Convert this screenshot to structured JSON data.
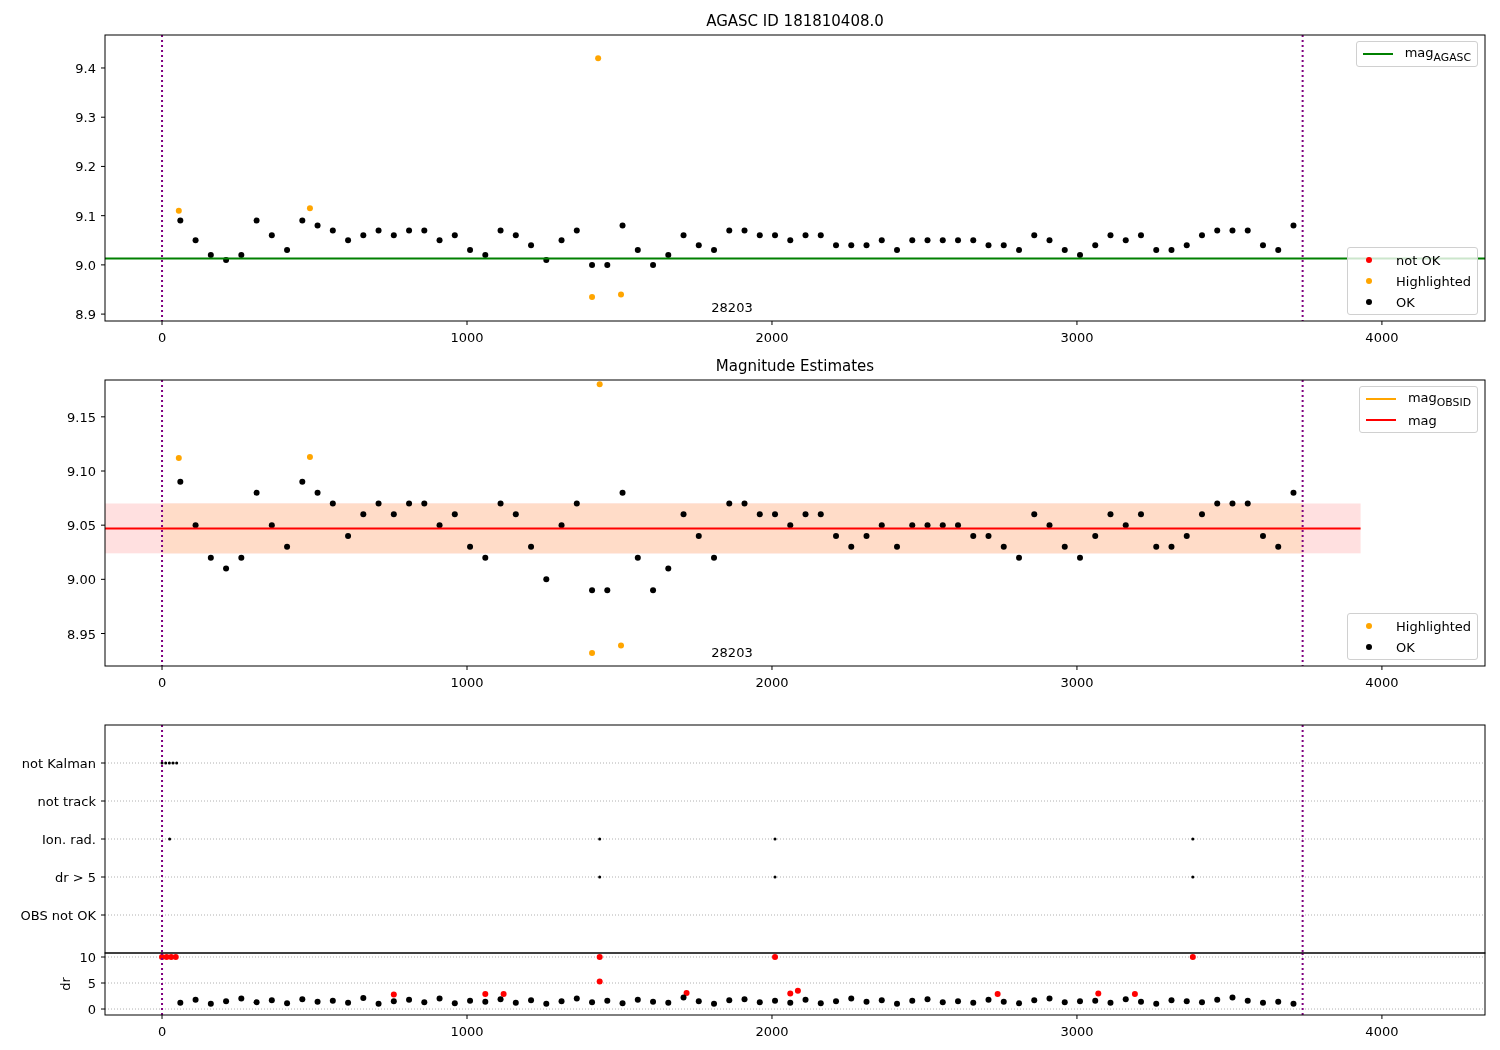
{
  "panels": [
    {
      "title": "AGASC ID 181810408.0",
      "legends": [
        {
          "entries": [
            {
              "kind": "line",
              "label": "mag$_{AGASC}$",
              "color": "#008000"
            }
          ]
        },
        {
          "entries": [
            {
              "kind": "dot",
              "label": "not OK",
              "color": "#ff0000"
            },
            {
              "kind": "dot",
              "label": "Highlighted",
              "color": "#ffa500"
            },
            {
              "kind": "dot",
              "label": "OK",
              "color": "#000000"
            }
          ]
        }
      ],
      "chart_data": {
        "type": "scatter",
        "xlim": [
          -187,
          4338
        ],
        "ylim": [
          8.886,
          9.467
        ],
        "xticks": [
          0,
          1000,
          2000,
          3000,
          4000
        ],
        "yticks": [
          {
            "value": 8.9,
            "label": "8.9"
          },
          {
            "value": 9.0,
            "label": "9.0"
          },
          {
            "value": 9.1,
            "label": "9.1"
          },
          {
            "value": 9.2,
            "label": "9.2"
          },
          {
            "value": 9.3,
            "label": "9.3"
          },
          {
            "value": 9.4,
            "label": "9.4"
          }
        ],
        "x": [
          60,
          110,
          160,
          210,
          260,
          310,
          360,
          410,
          460,
          510,
          560,
          610,
          660,
          710,
          760,
          810,
          860,
          910,
          960,
          1010,
          1060,
          1110,
          1160,
          1210,
          1260,
          1310,
          1360,
          1410,
          1460,
          1510,
          1560,
          1610,
          1660,
          1710,
          1760,
          1810,
          1860,
          1910,
          1960,
          2010,
          2060,
          2110,
          2160,
          2210,
          2260,
          2310,
          2360,
          2410,
          2460,
          2510,
          2560,
          2610,
          2660,
          2710,
          2760,
          2810,
          2860,
          2910,
          2960,
          3010,
          3060,
          3110,
          3160,
          3210,
          3260,
          3310,
          3360,
          3410,
          3460,
          3510,
          3560,
          3610,
          3660,
          3710
        ],
        "series": [
          {
            "color": "#ffa500",
            "x": [
              55,
              485,
              1430,
              1410,
              1505
            ],
            "values": [
              9.11,
              9.115,
              9.42,
              8.935,
              8.94
            ]
          },
          {
            "color": "#000000",
            "values": [
              9.09,
              9.05,
              9.02,
              9.01,
              9.02,
              9.09,
              9.06,
              9.03,
              9.09,
              9.08,
              9.07,
              9.05,
              9.06,
              9.07,
              9.06,
              9.07,
              9.07,
              9.05,
              9.06,
              9.03,
              9.02,
              9.07,
              9.06,
              9.04,
              9.01,
              9.05,
              9.07,
              9.0,
              9.0,
              9.08,
              9.03,
              9.0,
              9.02,
              9.06,
              9.04,
              9.03,
              9.07,
              9.07,
              9.06,
              9.06,
              9.05,
              9.06,
              9.06,
              9.04,
              9.04,
              9.04,
              9.05,
              9.03,
              9.05,
              9.05,
              9.05,
              9.05,
              9.05,
              9.04,
              9.04,
              9.03,
              9.06,
              9.05,
              9.03,
              9.02,
              9.04,
              9.06,
              9.05,
              9.06,
              9.03,
              9.03,
              9.04,
              9.06,
              9.07,
              9.07,
              9.07,
              9.04,
              9.03,
              9.08
            ]
          }
        ],
        "ref_lines": [
          {
            "axis": "y",
            "value": 9.013,
            "color": "#008000"
          },
          {
            "axis": "x",
            "value": 0,
            "color": "#800080"
          },
          {
            "axis": "x",
            "value": 3740,
            "color": "#800080"
          }
        ],
        "annotations": [
          "28203"
        ]
      }
    },
    {
      "title": "Magnitude Estimates",
      "legends": [
        {
          "entries": [
            {
              "kind": "line",
              "label": "mag$_{OBSID}$",
              "color": "#ffa500"
            },
            {
              "kind": "line",
              "label": "mag",
              "color": "#ff0000"
            }
          ]
        },
        {
          "entries": [
            {
              "kind": "dot",
              "label": "Highlighted",
              "color": "#ffa500"
            },
            {
              "kind": "dot",
              "label": "OK",
              "color": "#000000"
            }
          ]
        }
      ],
      "chart_data": {
        "type": "scatter",
        "xlim": [
          -187,
          4338
        ],
        "ylim": [
          8.92,
          9.184
        ],
        "xticks": [
          0,
          1000,
          2000,
          3000,
          4000
        ],
        "yticks": [
          {
            "value": 8.95,
            "label": "8.95"
          },
          {
            "value": 9.0,
            "label": "9.00"
          },
          {
            "value": 9.05,
            "label": "9.05"
          },
          {
            "value": 9.1,
            "label": "9.10"
          },
          {
            "value": 9.15,
            "label": "9.15"
          }
        ],
        "x": [
          60,
          110,
          160,
          210,
          260,
          310,
          360,
          410,
          460,
          510,
          560,
          610,
          660,
          710,
          760,
          810,
          860,
          910,
          960,
          1010,
          1060,
          1110,
          1160,
          1210,
          1260,
          1310,
          1360,
          1410,
          1460,
          1510,
          1560,
          1610,
          1660,
          1710,
          1760,
          1810,
          1860,
          1910,
          1960,
          2010,
          2060,
          2110,
          2160,
          2210,
          2260,
          2310,
          2360,
          2410,
          2460,
          2510,
          2560,
          2610,
          2660,
          2710,
          2760,
          2810,
          2860,
          2910,
          2960,
          3010,
          3060,
          3110,
          3160,
          3210,
          3260,
          3310,
          3360,
          3410,
          3460,
          3510,
          3560,
          3610,
          3660,
          3710
        ],
        "series": [
          {
            "color": "#ffa500",
            "x": [
              55,
              485,
              1435,
              1410,
              1505
            ],
            "values": [
              9.112,
              9.113,
              9.18,
              8.932,
              8.939
            ]
          },
          {
            "color": "#000000",
            "values": [
              9.09,
              9.05,
              9.02,
              9.01,
              9.02,
              9.08,
              9.05,
              9.03,
              9.09,
              9.08,
              9.07,
              9.04,
              9.06,
              9.07,
              9.06,
              9.07,
              9.07,
              9.05,
              9.06,
              9.03,
              9.02,
              9.07,
              9.06,
              9.03,
              9.0,
              9.05,
              9.07,
              8.99,
              8.99,
              9.08,
              9.02,
              8.99,
              9.01,
              9.06,
              9.04,
              9.02,
              9.07,
              9.07,
              9.06,
              9.06,
              9.05,
              9.06,
              9.06,
              9.04,
              9.03,
              9.04,
              9.05,
              9.03,
              9.05,
              9.05,
              9.05,
              9.05,
              9.04,
              9.04,
              9.03,
              9.02,
              9.06,
              9.05,
              9.03,
              9.02,
              9.04,
              9.06,
              9.05,
              9.06,
              9.03,
              9.03,
              9.04,
              9.06,
              9.07,
              9.07,
              9.07,
              9.04,
              9.03,
              9.08
            ]
          }
        ],
        "bands": [
          {
            "axis": "y",
            "from": 9.024,
            "to": 9.07,
            "color": "#ffe0e0"
          },
          {
            "axis": "y",
            "from": 9.024,
            "to": 9.07,
            "color": "#ffdcc8"
          }
        ],
        "ref_lines": [
          {
            "axis": "y",
            "value": 9.047,
            "color": "#ff0000"
          },
          {
            "axis": "x",
            "value": 0,
            "color": "#800080"
          },
          {
            "axis": "x",
            "value": 3740,
            "color": "#800080"
          }
        ],
        "annotations": [
          "28203"
        ]
      }
    },
    {
      "row_labels": [
        "not Kalman",
        "not track",
        "Ion. rad.",
        "dr > 5",
        "OBS not OK"
      ]
    },
    {
      "chart_data": {
        "type": "scatter",
        "grid": true,
        "ylabel": "dr",
        "xlim": [
          -187,
          4338
        ],
        "ylim": [
          -1.15,
          10.77
        ],
        "xticks": [
          0,
          1000,
          2000,
          3000,
          4000
        ],
        "yticks": [
          {
            "value": 0,
            "label": "0"
          },
          {
            "value": 5,
            "label": "5"
          },
          {
            "value": 10,
            "label": "10"
          }
        ],
        "x": [
          60,
          110,
          160,
          210,
          260,
          310,
          360,
          410,
          460,
          510,
          560,
          610,
          660,
          710,
          760,
          810,
          860,
          910,
          960,
          1010,
          1060,
          1110,
          1160,
          1210,
          1260,
          1310,
          1360,
          1410,
          1460,
          1510,
          1560,
          1610,
          1660,
          1710,
          1760,
          1810,
          1860,
          1910,
          1960,
          2010,
          2060,
          2110,
          2160,
          2210,
          2260,
          2310,
          2360,
          2410,
          2460,
          2510,
          2560,
          2610,
          2660,
          2710,
          2760,
          2810,
          2860,
          2910,
          2960,
          3010,
          3060,
          3110,
          3160,
          3210,
          3260,
          3310,
          3360,
          3410,
          3460,
          3510,
          3560,
          3610,
          3660,
          3710
        ],
        "series": [
          {
            "color": "#ff0000",
            "x": [
              0,
              15,
              30,
              45,
              1435,
              1435,
              2010,
              3380,
              760,
              1060,
              1120,
              1720,
              2060,
              2085,
              2740,
              3070,
              3190
            ],
            "values": [
              10,
              10,
              10,
              10,
              10,
              5.3,
              10,
              10,
              2.8,
              2.9,
              2.9,
              3.1,
              3,
              3.5,
              2.9,
              3,
              2.9
            ]
          },
          {
            "color": "#000000",
            "values": [
              1.2,
              1.8,
              1.0,
              1.5,
              2.0,
              1.3,
              1.7,
              1.1,
              1.9,
              1.4,
              1.6,
              1.2,
              2.1,
              1.0,
              1.5,
              1.8,
              1.3,
              2.0,
              1.1,
              1.6,
              1.4,
              1.9,
              1.2,
              1.7,
              1.0,
              1.5,
              2.0,
              1.3,
              1.6,
              1.1,
              1.8,
              1.4,
              1.2,
              2.2,
              1.5,
              1.0,
              1.7,
              1.9,
              1.3,
              1.6,
              1.2,
              1.8,
              1.1,
              1.5,
              2.0,
              1.4,
              1.7,
              1.0,
              1.6,
              1.9,
              1.3,
              1.5,
              1.2,
              1.8,
              1.4,
              1.1,
              1.7,
              2.0,
              1.3,
              1.5,
              1.6,
              1.2,
              1.9,
              1.4,
              1.0,
              1.7,
              1.5,
              1.3,
              1.8,
              2.2,
              1.6,
              1.2,
              1.4,
              1.0
            ]
          }
        ],
        "ref_lines": [
          {
            "axis": "x",
            "value": 0,
            "color": "#800080"
          },
          {
            "axis": "x",
            "value": 3740,
            "color": "#800080"
          }
        ]
      }
    }
  ]
}
